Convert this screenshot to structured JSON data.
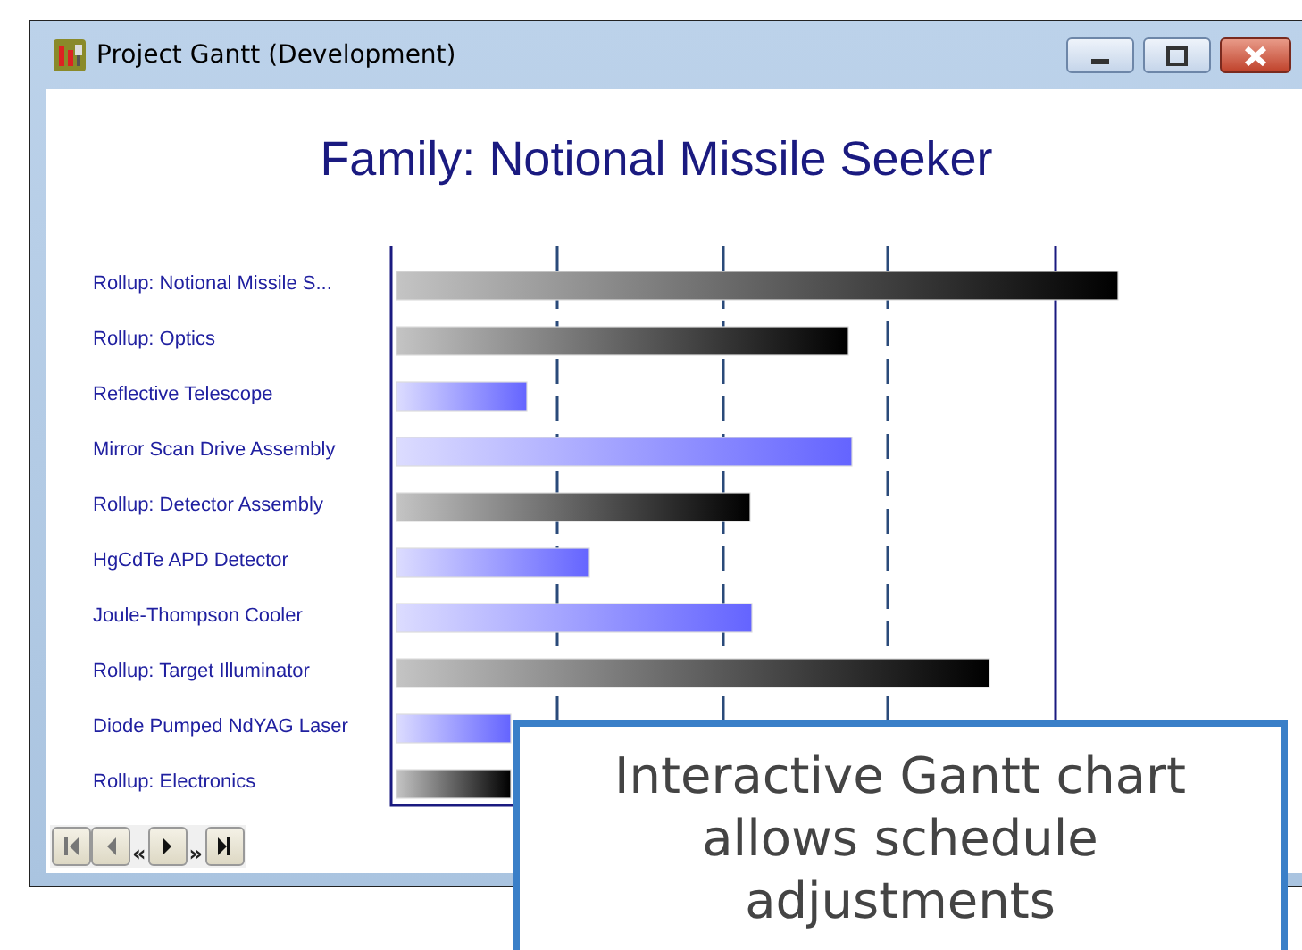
{
  "window": {
    "title": "Project Gantt (Development)",
    "controls": [
      {
        "kind": "minimize"
      },
      {
        "kind": "maximize"
      },
      {
        "kind": "close"
      }
    ]
  },
  "chart": {
    "title": "Family: Notional Missile Seeker",
    "rows": [
      {
        "label": "Rollup: Notional Missile S...",
        "kind": "rollup"
      },
      {
        "label": "Rollup: Optics",
        "kind": "rollup"
      },
      {
        "label": "Reflective Telescope",
        "kind": "task"
      },
      {
        "label": "Mirror Scan Drive Assembly",
        "kind": "task"
      },
      {
        "label": "Rollup: Detector Assembly",
        "kind": "rollup"
      },
      {
        "label": "HgCdTe APD Detector",
        "kind": "task"
      },
      {
        "label": "Joule-Thompson Cooler",
        "kind": "task"
      },
      {
        "label": "Rollup: Target Illuminator",
        "kind": "rollup"
      },
      {
        "label": "Diode Pumped NdYAG Laser",
        "kind": "task"
      },
      {
        "label": "Rollup: Electronics",
        "kind": "rollup"
      }
    ]
  },
  "navigation": {
    "buttons": [
      {
        "kind": "first"
      },
      {
        "kind": "prev"
      },
      {
        "kind": "text",
        "label": "«"
      },
      {
        "kind": "next"
      },
      {
        "kind": "text",
        "label": "»"
      },
      {
        "kind": "last"
      }
    ]
  },
  "callout": {
    "text": "Interactive Gantt chart allows schedule adjustments"
  }
}
